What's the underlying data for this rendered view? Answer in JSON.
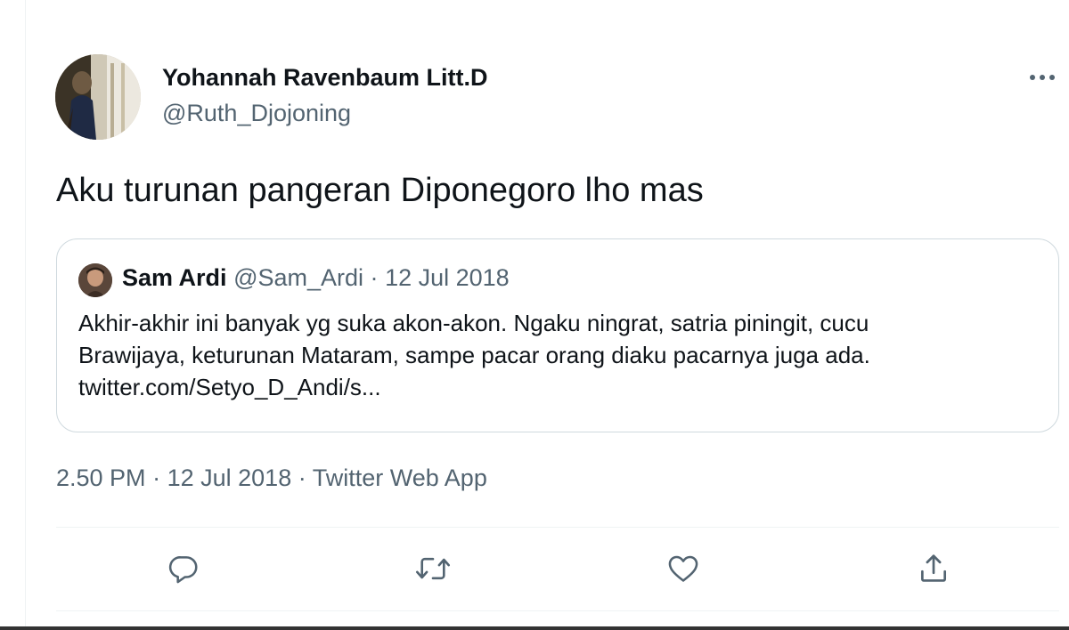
{
  "tweet": {
    "author": {
      "name": "Yohannah Ravenbaum Litt.D",
      "handle": "@Ruth_Djojoning"
    },
    "text": "Aku turunan pangeran Diponegoro lho mas",
    "quoted": {
      "name": "Sam Ardi",
      "handle": "@Sam_Ardi",
      "separator": "·",
      "date": "12 Jul 2018",
      "lines": [
        "Akhir-akhir ini banyak yg suka akon-akon. Ngaku ningrat, satria piningit, cucu",
        "Brawijaya, keturunan Mataram, sampe pacar orang diaku pacarnya juga ada.",
        "twitter.com/Setyo_D_Andi/s..."
      ]
    },
    "meta": {
      "time": "2.50 PM",
      "sep1": "·",
      "date": "12 Jul 2018",
      "sep2": "·",
      "source": "Twitter Web App"
    }
  },
  "actions": {
    "reply": "reply-icon",
    "retweet": "retweet-icon",
    "like": "heart-icon",
    "share": "share-icon",
    "more": "more-icon"
  },
  "colors": {
    "text": "#0f1419",
    "secondary": "#536471",
    "border": "#cfd9de",
    "divider": "#eff3f4"
  }
}
